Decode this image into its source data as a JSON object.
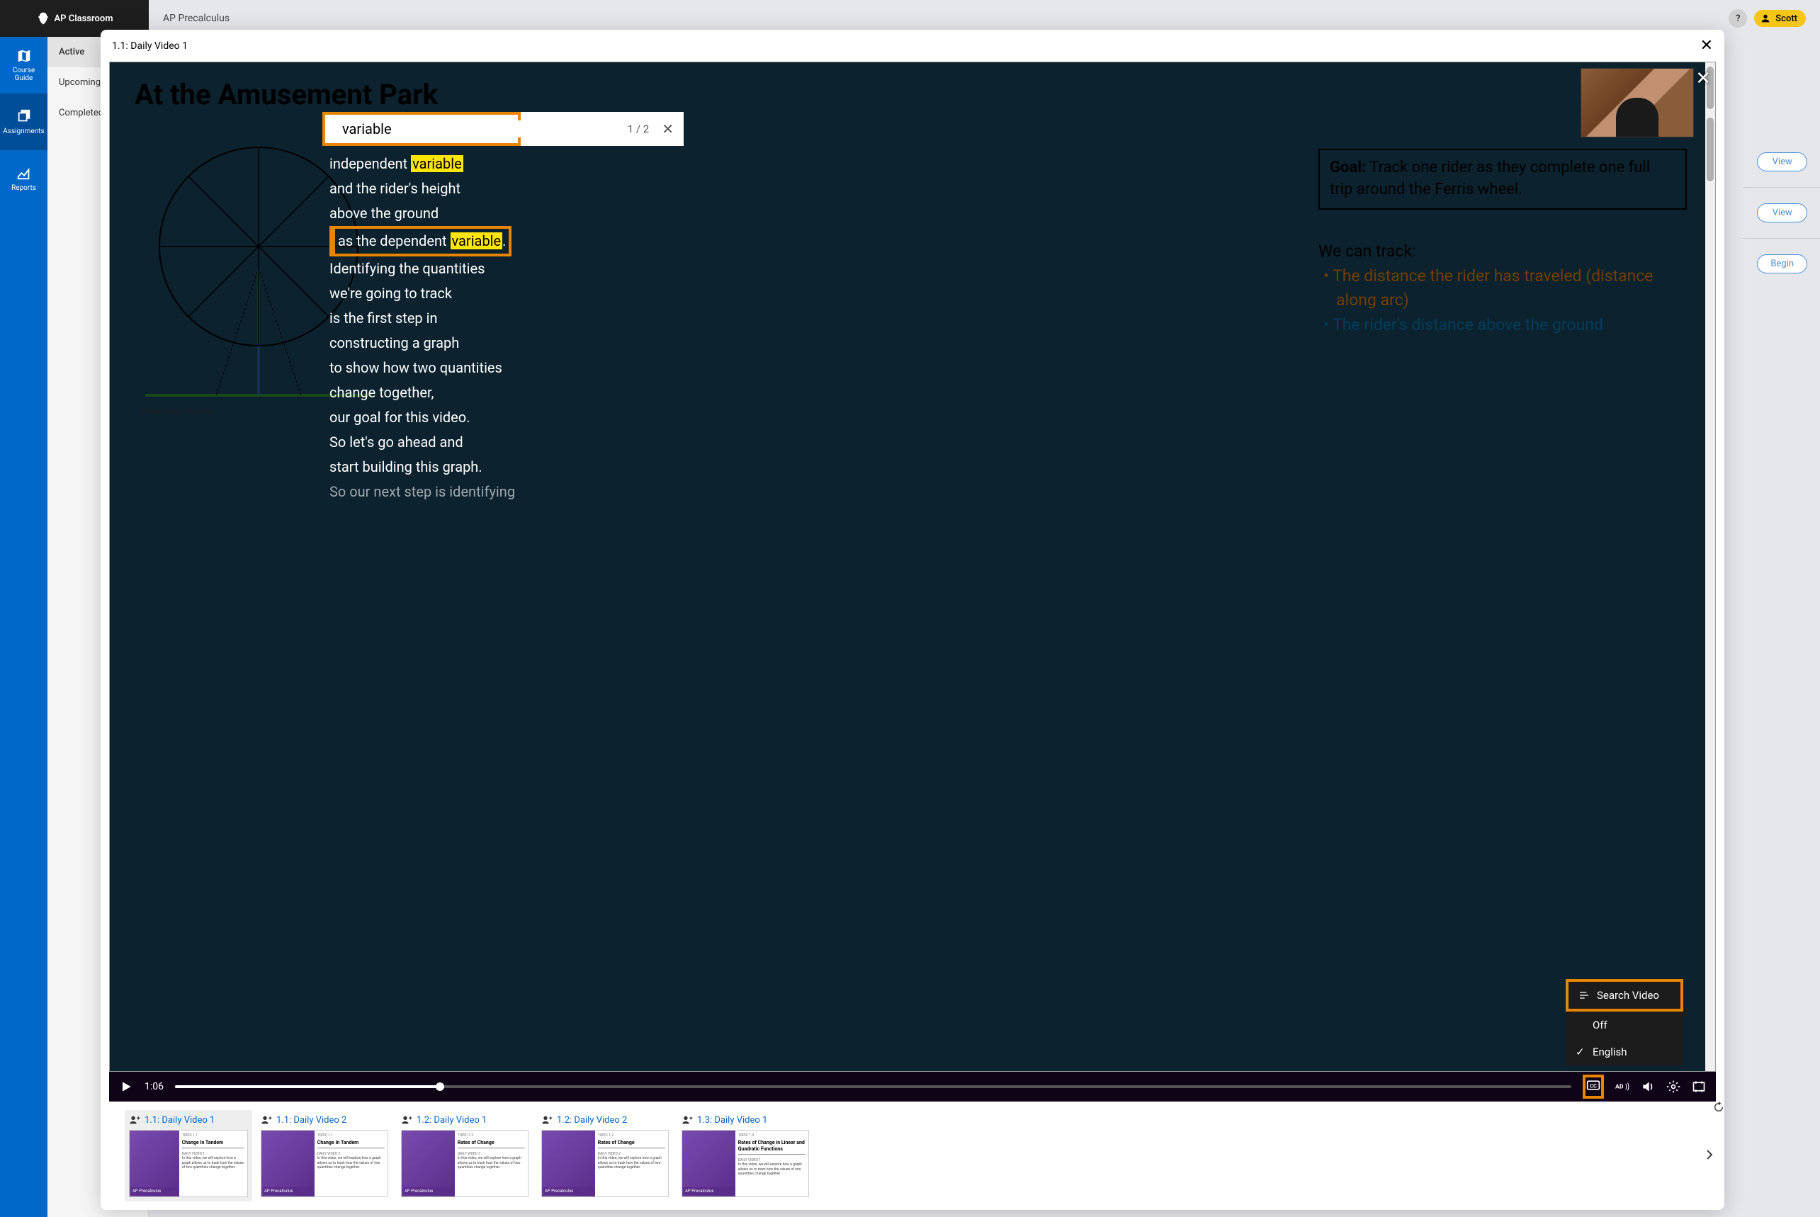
{
  "brand": "AP Classroom",
  "course": "AP Precalculus",
  "user": {
    "name": "Scott",
    "help": "?"
  },
  "leftnav": [
    {
      "label": "Course Guide"
    },
    {
      "label": "Assignments"
    },
    {
      "label": "Reports"
    }
  ],
  "subnav": [
    {
      "label": "Active",
      "active": true
    },
    {
      "label": "Upcoming"
    },
    {
      "label": "Completed"
    }
  ],
  "side_actions": [
    "View",
    "View",
    "Begin"
  ],
  "modal": {
    "title": "1.1: Daily Video 1",
    "time": "1:06",
    "search": {
      "value": "variable",
      "count": "1 / 2"
    },
    "slide": {
      "title": "At the Amusement Park",
      "desmos": "Powered by Desmos",
      "goal_label": "Goal:",
      "goal_text": " Track one rider as they complete one full trip around the Ferris wheel.",
      "track_head": "We can track:",
      "track_1": "• The distance the rider has traveled (distance along arc)",
      "track_2": "• The rider's distance above the ground"
    },
    "transcript": {
      "l1a": "independent ",
      "l1b": "variable",
      "l2": "and the rider's height",
      "l3": "above the ground",
      "l4a": "as the dependent ",
      "l4b": "variable",
      "l4c": ".",
      "l5": "Identifying the quantities",
      "l6": "we're going to track",
      "l7": "is the first step in",
      "l8": "constructing a graph",
      "l9": "to show how two quantities",
      "l10": "change together,",
      "l11": "our goal for this video.",
      "l12": "So let's go ahead and",
      "l13": "start building this graph.",
      "l14": "So our next step is identifying"
    },
    "cc_menu": {
      "search": "Search Video",
      "off": "Off",
      "english": "English"
    }
  },
  "thumbs": [
    {
      "title": "1.1: Daily Video 1",
      "topic": "TOPIC 1.1",
      "name": "Change In Tandem",
      "dv": "DAILY VIDEO 1",
      "selected": true
    },
    {
      "title": "1.1: Daily Video 2",
      "topic": "TOPIC 1.1",
      "name": "Change In Tandem",
      "dv": "DAILY VIDEO 2"
    },
    {
      "title": "1.2: Daily Video 1",
      "topic": "TOPIC 1.2",
      "name": "Rates of Change",
      "dv": "DAILY VIDEO 1"
    },
    {
      "title": "1.2: Daily Video 2",
      "topic": "TOPIC 1.2",
      "name": "Rates of Change",
      "dv": "DAILY VIDEO 2",
      "rewatch": true
    },
    {
      "title": "1.3: Daily Video 1",
      "topic": "TOPIC 1.3",
      "name": "Rates of Change in Linear and Quadratic Functions",
      "dv": "DAILY VIDEO 1"
    }
  ],
  "thumb_brand": "AP Precalculus"
}
